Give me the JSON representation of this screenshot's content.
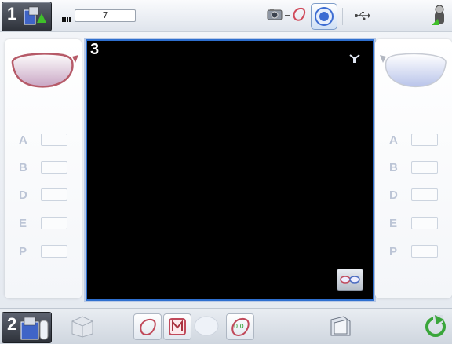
{
  "header": {
    "panel1_number": "1",
    "counter_value": "7",
    "icons": [
      "panel-1-icon",
      "counter-icon",
      "camera-icon",
      "lens-shape-icon",
      "target-icon",
      "usb-icon",
      "user-icon"
    ]
  },
  "main": {
    "screen_number": "3",
    "screen_icons": [
      "frame-icon",
      "glasses-view-icon"
    ]
  },
  "left_panel": {
    "labels": [
      "A",
      "B",
      "D",
      "E",
      "P"
    ]
  },
  "right_panel": {
    "labels": [
      "A",
      "B",
      "D",
      "E",
      "P"
    ]
  },
  "footer": {
    "panel2_number": "2",
    "bevel_value": "0.0",
    "icons": [
      "panel-2-icon",
      "lens-box-icon",
      "lens-outline-icon",
      "mirror-m-icon",
      "blank-lens-icon",
      "bevel-icon",
      "folder-icon",
      "refresh-icon"
    ]
  },
  "colors": {
    "accent": "#2e6fcf",
    "screen_bg": "#000000",
    "left_lens": "#c77c8e",
    "right_lens": "#a9b6e6",
    "refresh": "#3aa63a"
  }
}
